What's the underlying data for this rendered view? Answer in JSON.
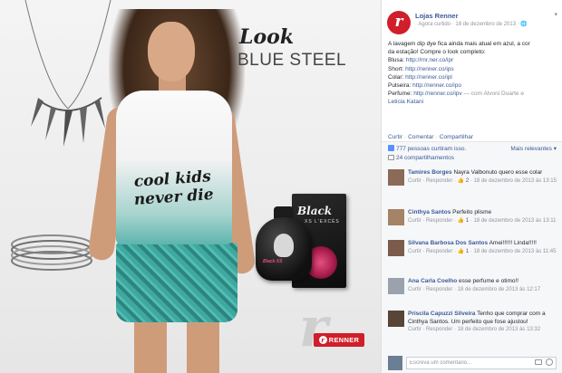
{
  "photo": {
    "look_title": "Look",
    "look_subtitle": "BLUE STEEL",
    "shirt_text": "cool kids never die",
    "perfume_brand": "Black",
    "perfume_sub": "XS L'EXCÈS",
    "bottle_label": "Black XS",
    "watermark": "r",
    "badge_label": "RENNER",
    "badge_icon": "r"
  },
  "post": {
    "page_logo": "r",
    "page_name": "Lojas Renner",
    "meta": "· Agora curtido · 18 de dezembro de 2013 · ",
    "globe_icon": "🌐",
    "chevron": "▾",
    "lines": [
      {
        "text": "A lavagem dip dye fica ainda mais atual em azul, a cor",
        "link": ""
      },
      {
        "text": "da estação! Compre o look completo:",
        "link": ""
      },
      {
        "text": "Blusa: ",
        "link": "http://rnr.ner.co/ipr"
      },
      {
        "text": "Short: ",
        "link": "http://renner.co/ips"
      },
      {
        "text": "Colar: ",
        "link": "http://renner.co/ipl"
      },
      {
        "text": "Pulseira: ",
        "link": "http://renner.co/ipo"
      },
      {
        "text": "Perfume: ",
        "link": "http://renner.co/ipv",
        "tail": " — com Alvoni Duarte e"
      },
      {
        "text": "",
        "link": "Leticia Katani"
      }
    ],
    "actions": {
      "curtir": "Curtir",
      "comentar": "Comentar",
      "compartilhar": "Compartilhar"
    }
  },
  "ufi": {
    "likes_text": "777 pessoas curtiram isso.",
    "relevance": "Mais relevantes ▾",
    "shares_text": "24 compartilhamentos",
    "comments": [
      {
        "author": "Tamires Borges",
        "text": " Nayra Valbonuto quero esse colar",
        "meta_prefix": "Curtir · Responder · ",
        "likes": "2",
        "date": " · 18 de dezembro de 2013 às 13:15",
        "avatar_color": "#8b6a58"
      },
      {
        "author": "Cinthya Santos",
        "text": " Perfeito plisme",
        "meta_prefix": "Curtir · Responder · ",
        "likes": "1",
        "date": " · 18 de dezembro de 2013 às 13:11",
        "avatar_color": "#a48366"
      },
      {
        "author": "Silvana Barbosa Dos Santos",
        "text": " Amei!!!!!! Linda!!!!!",
        "meta_prefix": "Curtir · Responder · ",
        "likes": "1",
        "date": " · 18 de dezembro de 2013 às 11:45",
        "avatar_color": "#7b5b4b"
      },
      {
        "author": "Ana Carla Coelho",
        "text": " esse perfume e otimo!!",
        "meta_prefix": "Curtir · Responder · ",
        "likes": "",
        "date": "18 de dezembro de 2013 às 12:17",
        "avatar_color": "#9aa3ad"
      },
      {
        "author": "Priscila Capuzzi Silveira",
        "text": " Tenho que comprar com a Cinthya Santos. Um perfeito que fose ajustou!",
        "meta_prefix": "Curtir · Responder · ",
        "likes": "",
        "date": "18 de dezembro de 2013 às 13:32",
        "avatar_color": "#574538"
      }
    ],
    "write_placeholder": "Escreva um comentário...",
    "camera_icon": "camera-icon",
    "emoji_icon": "emoji-icon"
  },
  "colors": {
    "brand_red": "#d01e2a",
    "link_blue": "#3b5998",
    "meta_gray": "#90949c",
    "ufi_bg": "#f6f7f9"
  }
}
